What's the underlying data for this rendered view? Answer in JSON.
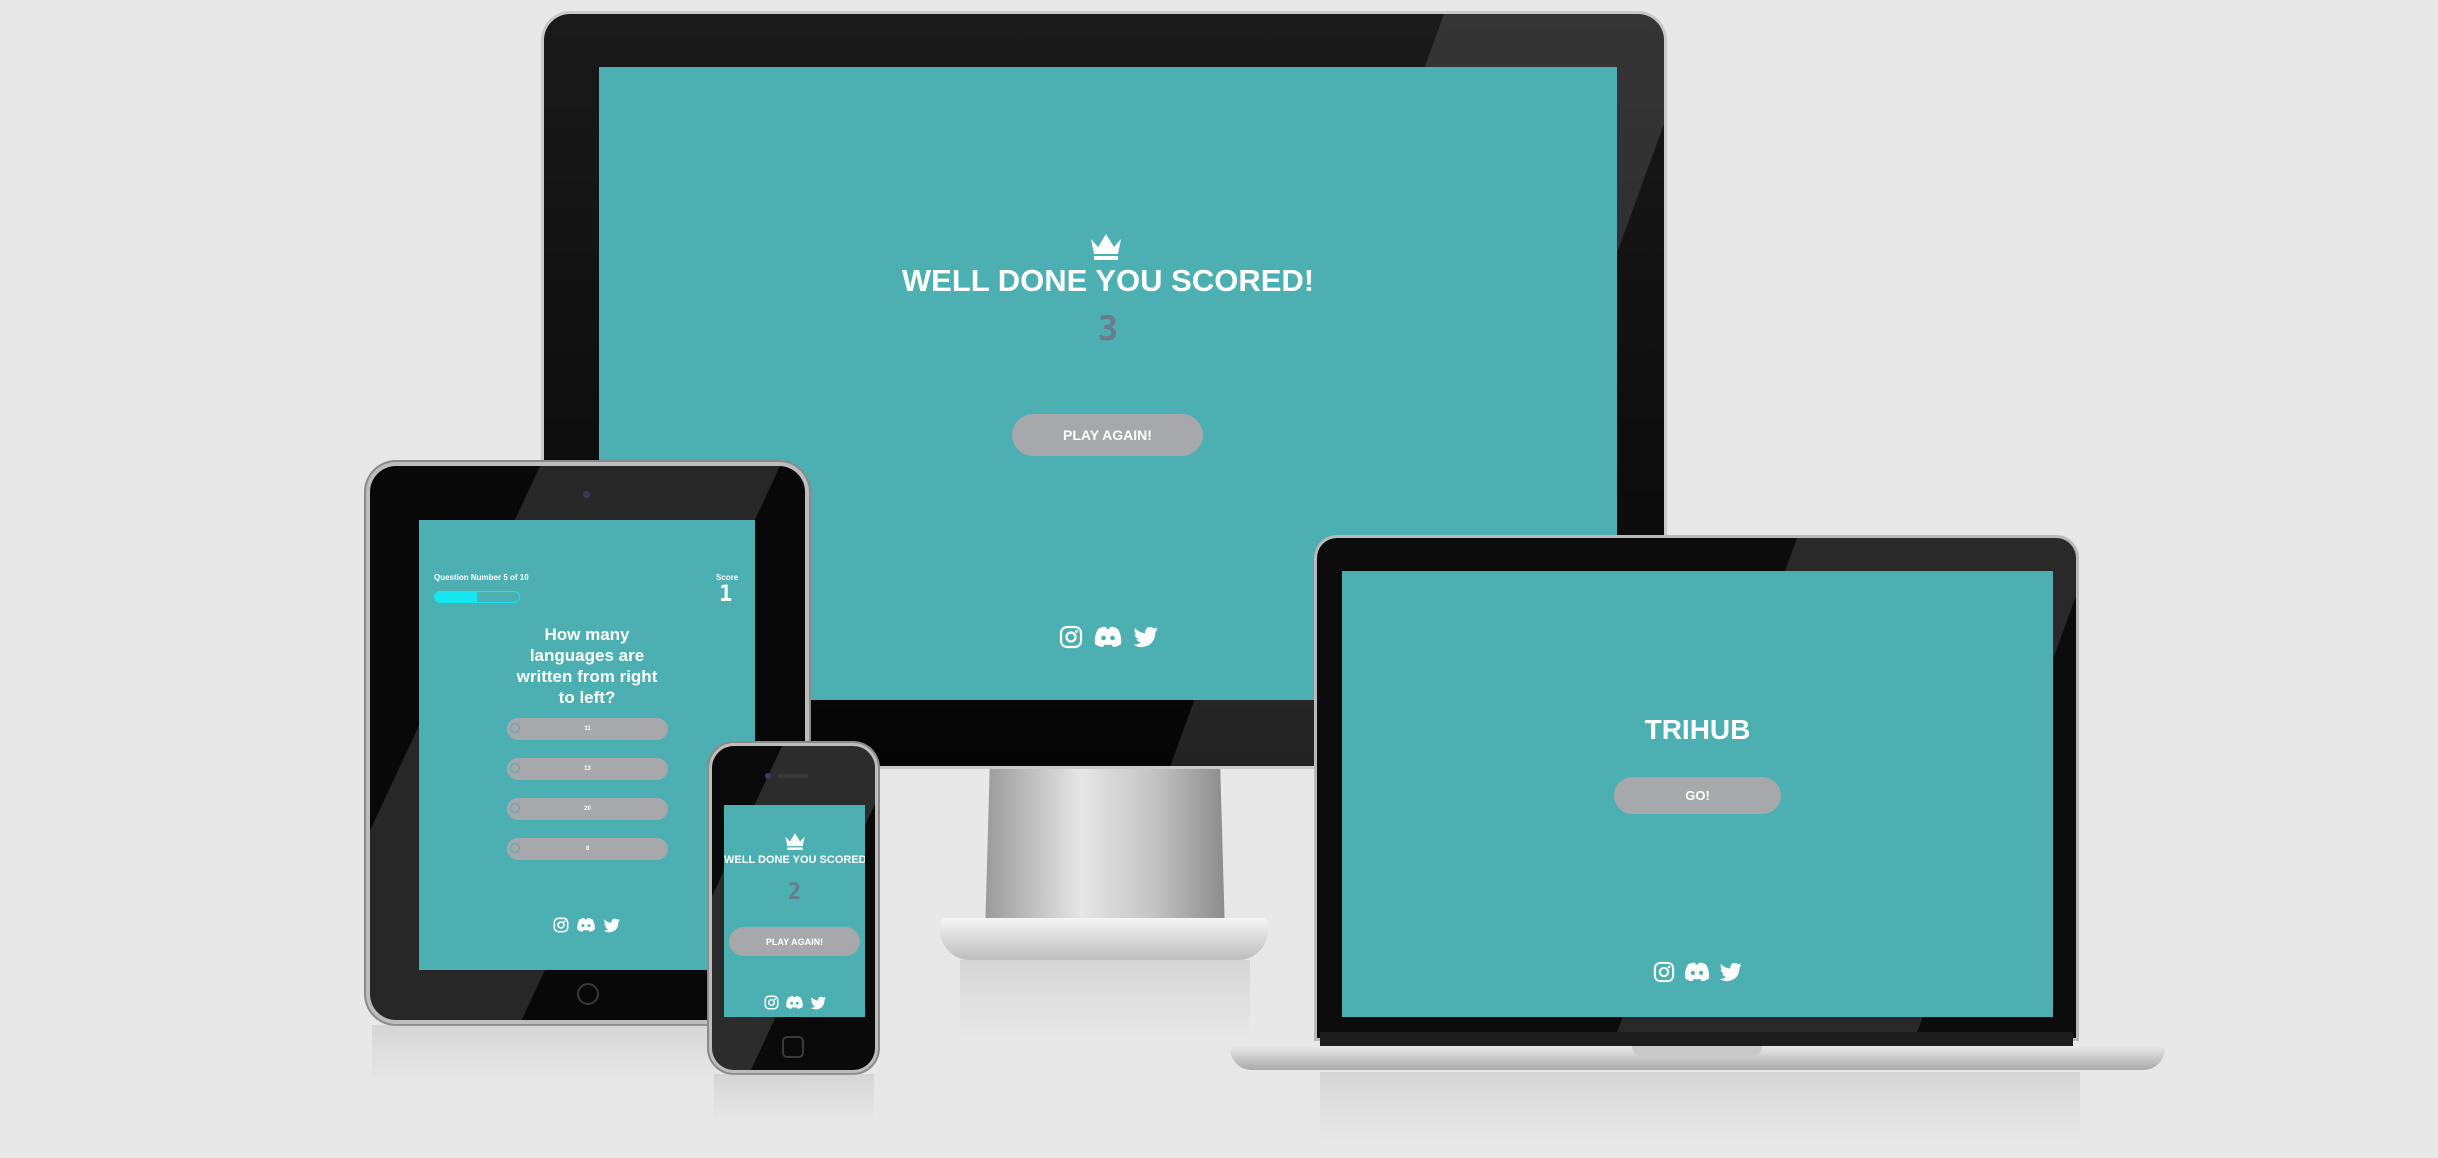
{
  "monitor": {
    "title": "WELL DONE YOU SCORED!",
    "score": "3",
    "button": "PLAY AGAIN!"
  },
  "tablet": {
    "question_number": "Question Number 5 of 10",
    "progress": 0.5,
    "score_label": "Score",
    "score": "1",
    "question": "How many languages are written from right to left?",
    "answers": [
      "11",
      "13",
      "20",
      "8"
    ]
  },
  "phone": {
    "title": "WELL DONE YOU SCORED",
    "score": "2",
    "button": "PLAY AGAIN!"
  },
  "laptop": {
    "title": "TRIHUB",
    "button": "GO!"
  },
  "icons": [
    "crown-icon",
    "instagram-icon",
    "discord-icon",
    "twitter-icon"
  ],
  "colors": {
    "screen_bg": "#4cafb1",
    "button_bg": "#a7a8ab",
    "score_text": "#6c7b8a",
    "progress_fill": "#16e6f0",
    "page_bg": "#e8e8e8"
  }
}
